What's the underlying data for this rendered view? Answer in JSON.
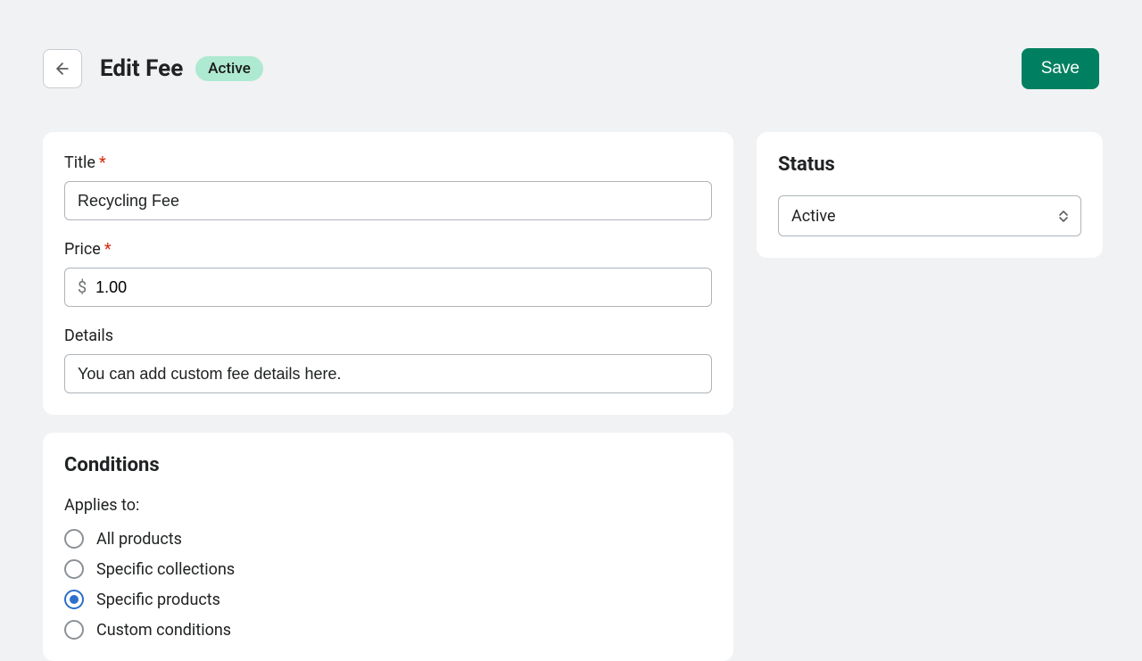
{
  "header": {
    "title": "Edit Fee",
    "status_pill": "Active",
    "save_label": "Save"
  },
  "form": {
    "title_label": "Title",
    "title_value": "Recycling Fee",
    "price_label": "Price",
    "price_prefix": "$",
    "price_value": "1.00",
    "details_label": "Details",
    "details_value": "You can add custom fee details here."
  },
  "conditions": {
    "heading": "Conditions",
    "applies_label": "Applies to:",
    "options": [
      {
        "label": "All products",
        "checked": false
      },
      {
        "label": "Specific collections",
        "checked": false
      },
      {
        "label": "Specific products",
        "checked": true
      },
      {
        "label": "Custom conditions",
        "checked": false
      }
    ]
  },
  "status_card": {
    "heading": "Status",
    "value": "Active"
  }
}
